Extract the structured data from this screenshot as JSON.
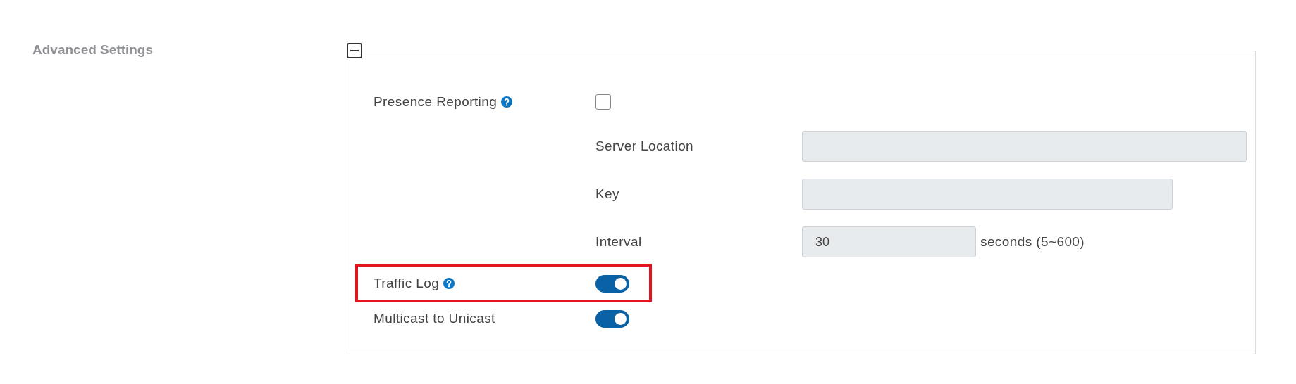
{
  "section": {
    "title": "Advanced Settings",
    "expanded": true
  },
  "rows": [
    {
      "kind": "checkbox",
      "label": "Presence Reporting",
      "help": true,
      "checked": false
    },
    {
      "kind": "field",
      "label": "Server Location",
      "disabled": true
    },
    {
      "kind": "field",
      "label": "Key",
      "disabled": true
    },
    {
      "kind": "field",
      "label": "Interval",
      "value": "30",
      "suffix": "seconds (5~600)",
      "disabled": true
    },
    {
      "kind": "toggle",
      "label": "Traffic Log",
      "help": true,
      "on": true,
      "highlighted": true
    },
    {
      "kind": "toggle",
      "label": "Multicast to Unicast",
      "on": true
    }
  ]
}
